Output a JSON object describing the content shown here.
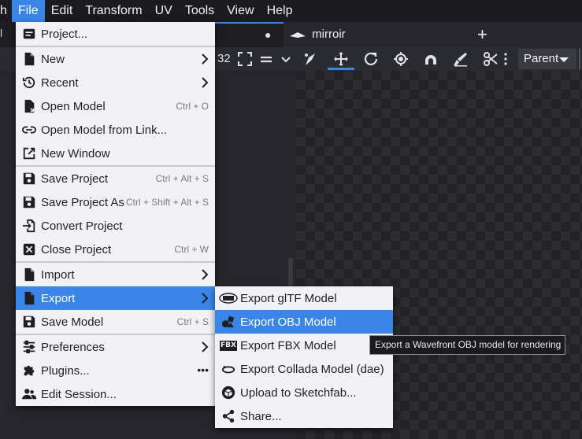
{
  "menubar": {
    "cut_label": "h",
    "items": [
      "File",
      "Edit",
      "Transform",
      "UV",
      "Tools",
      "View",
      "Help"
    ]
  },
  "tabs": {
    "left_cut": "l",
    "unsaved_marker": "●",
    "active_tab": "mirroir",
    "add": "+"
  },
  "toolbar": {
    "zoom_value": "32",
    "pivot_dropdown": "Parent"
  },
  "file_menu": {
    "items": [
      {
        "label": "Project...",
        "icon": "project-icon",
        "shortcut": ""
      },
      {
        "label": "New",
        "icon": "new-file-icon",
        "submenu": true
      },
      {
        "label": "Recent",
        "icon": "history-icon",
        "submenu": true
      },
      {
        "label": "Open Model",
        "icon": "open-file-icon",
        "shortcut": "Ctrl + O"
      },
      {
        "label": "Open Model from Link...",
        "icon": "link-icon",
        "shortcut": ""
      },
      {
        "label": "New Window",
        "icon": "new-window-icon",
        "shortcut": ""
      },
      {
        "label": "Save Project",
        "icon": "save-icon",
        "shortcut": "Ctrl + Alt + S"
      },
      {
        "label": "Save Project As",
        "icon": "save-icon",
        "shortcut": "Ctrl + Shift + Alt + S"
      },
      {
        "label": "Convert Project",
        "icon": "convert-icon",
        "shortcut": ""
      },
      {
        "label": "Close Project",
        "icon": "close-box-icon",
        "shortcut": "Ctrl + W"
      },
      {
        "label": "Import",
        "icon": "import-file-icon",
        "submenu": true
      },
      {
        "label": "Export",
        "icon": "export-file-icon",
        "submenu": true
      },
      {
        "label": "Save Model",
        "icon": "save-icon",
        "shortcut": "Ctrl + S"
      },
      {
        "label": "Preferences",
        "icon": "sliders-icon",
        "submenu": true
      },
      {
        "label": "Plugins...",
        "icon": "puzzle-icon",
        "more": "•••"
      },
      {
        "label": "Edit Session...",
        "icon": "users-icon",
        "shortcut": ""
      }
    ]
  },
  "export_menu": {
    "items": [
      {
        "label": "Export glTF Model",
        "icon": "gltf-icon"
      },
      {
        "label": "Export OBJ Model",
        "icon": "obj-shapes-icon"
      },
      {
        "label": "Export FBX Model",
        "icon": "fbx-icon",
        "icon_text": "FBX"
      },
      {
        "label": "Export Collada Model (dae)",
        "icon": "collada-icon"
      },
      {
        "label": "Upload to Sketchfab...",
        "icon": "sketchfab-icon"
      },
      {
        "label": "Share...",
        "icon": "share-icon"
      }
    ]
  },
  "tooltip": "Export a Wavefront OBJ model for rendering",
  "colors": {
    "accent": "#3a86e8",
    "menu_bg": "#f2f2f6",
    "app_bg": "#1e1e23"
  }
}
